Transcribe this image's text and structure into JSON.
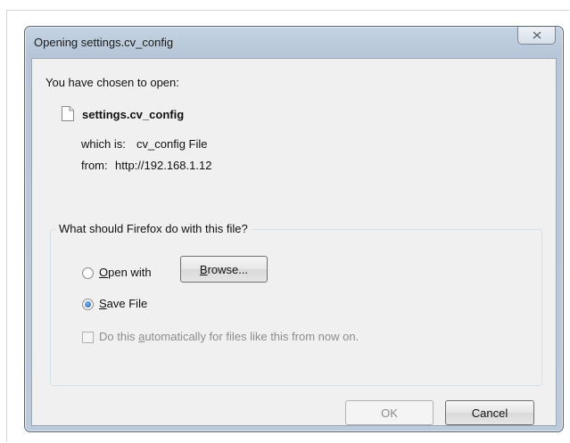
{
  "dialog": {
    "title": "Opening settings.cv_config",
    "intro": "You have chosen to open:",
    "file_name": "settings.cv_config",
    "which_is_label": "which is:",
    "which_is_value": "cv_config File",
    "from_label": "from:",
    "from_value": "http://192.168.1.12",
    "question": "What should Firefox do with this file?",
    "open_with": {
      "mnemonic": "O",
      "rest": "pen with",
      "checked": false
    },
    "browse": {
      "mnemonic": "B",
      "rest": "rowse..."
    },
    "save_file": {
      "mnemonic": "S",
      "rest": "ave File",
      "checked": true
    },
    "auto_option": {
      "before": "Do this ",
      "mnemonic": "a",
      "after": "utomatically for files like this from now on.",
      "checked": false,
      "enabled": false
    },
    "ok_label": "OK",
    "cancel_label": "Cancel"
  }
}
